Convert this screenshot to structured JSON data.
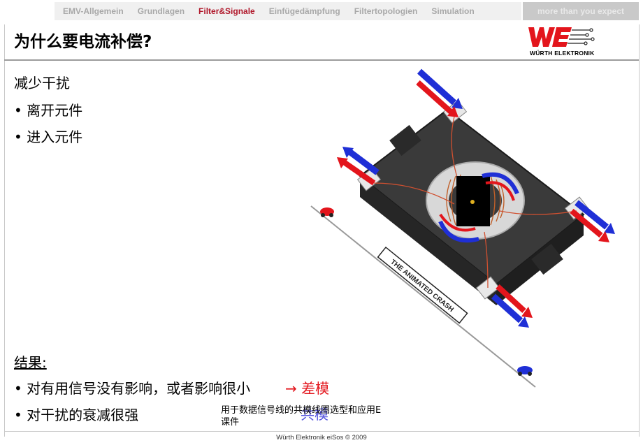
{
  "nav": {
    "tabs": [
      {
        "label": "EMV-Allgemein",
        "active": false
      },
      {
        "label": "Grundlagen",
        "active": false
      },
      {
        "label": "Filter&Signale",
        "active": true
      },
      {
        "label": "Einfügedämpfung",
        "active": false
      },
      {
        "label": "Filtertopologien",
        "active": false
      },
      {
        "label": "Simulation",
        "active": false
      }
    ],
    "tagline": "more than you expect"
  },
  "slide": {
    "title": "为什么要电流补偿?",
    "section1_heading": "减少干扰",
    "bullet1": "• 离开元件",
    "bullet2": "• 进入元件",
    "result_label": "结果:",
    "result_bullet1": "• 对有用信号没有影响，或者影响很小",
    "result_bullet1_arrow": "→ 差模",
    "result_bullet2": "•  对干扰的衰减很强",
    "result_bullet2_ghost": "共模",
    "caption_line1": "用于数据信号线的共模线圈选型和应用E",
    "caption_line2": "课件"
  },
  "illustration": {
    "road_sign": "THE ANIMATED CRASH"
  },
  "logo": {
    "text": "WÜRTH ELEKTRONIK"
  },
  "footer": {
    "text": "Würth Elektronik eiSos © 2009"
  },
  "colors": {
    "brand_red": "#e3151c",
    "nav_active": "#b0172a",
    "arrow_blue": "#1f2fd6",
    "arrow_red": "#e3151c"
  }
}
